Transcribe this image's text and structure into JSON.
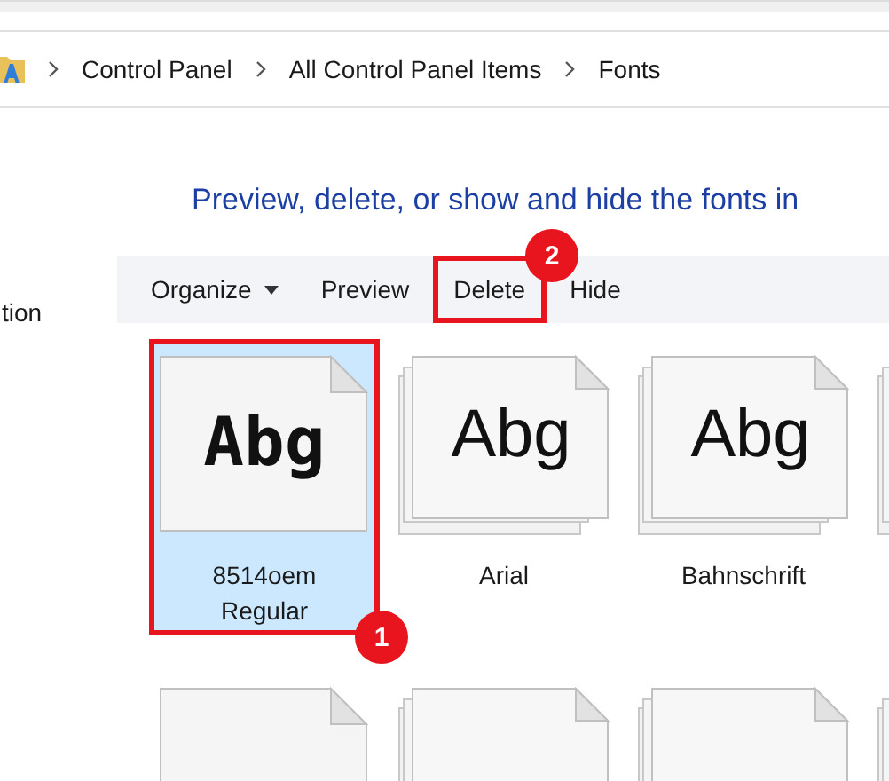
{
  "breadcrumb": [
    "Control Panel",
    "All Control Panel Items",
    "Fonts"
  ],
  "heading": "Preview, delete, or show and hide the fonts in",
  "sidebar": {
    "partial_link": "tion"
  },
  "toolbar": [
    {
      "label": "Organize",
      "kind": "menu",
      "highlighted": false
    },
    {
      "label": "Preview",
      "kind": "button",
      "highlighted": false
    },
    {
      "label": "Delete",
      "kind": "button",
      "highlighted": true,
      "callout": "2"
    },
    {
      "label": "Hide",
      "kind": "button",
      "highlighted": false
    }
  ],
  "fonts": [
    {
      "name": "8514oem Regular",
      "preview": "Abg",
      "kind": "pixel",
      "stacked": false,
      "selected": true,
      "highlighted": true,
      "callout": "1"
    },
    {
      "name": "Arial",
      "preview": "Abg",
      "kind": "sans",
      "stacked": true,
      "selected": false,
      "highlighted": false
    },
    {
      "name": "Bahnschrift",
      "preview": "Abg",
      "kind": "sans",
      "stacked": true,
      "selected": false,
      "highlighted": false
    },
    {
      "stacked": true,
      "selected": false,
      "highlighted": false
    },
    {
      "stacked": false,
      "selected": false,
      "highlighted": false
    },
    {
      "stacked": true,
      "selected": false,
      "highlighted": false
    },
    {
      "stacked": true,
      "selected": false,
      "highlighted": false
    },
    {
      "stacked": true,
      "selected": false,
      "highlighted": false
    }
  ]
}
